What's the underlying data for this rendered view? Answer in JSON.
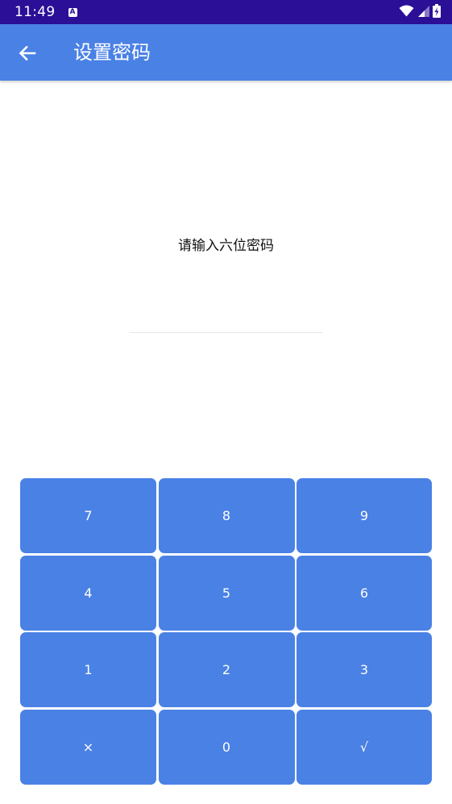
{
  "status_bar": {
    "time": "11:49",
    "icons": [
      "accessibility-icon",
      "wifi-icon",
      "signal-icon",
      "battery-charging-icon"
    ]
  },
  "app_bar": {
    "title": "设置密码",
    "back_icon": "arrow-left-icon"
  },
  "main": {
    "prompt": "请输入六位密码",
    "password_value": ""
  },
  "keypad": {
    "keys": [
      "7",
      "8",
      "9",
      "4",
      "5",
      "6",
      "1",
      "2",
      "3",
      "×",
      "0",
      "√"
    ]
  },
  "colors": {
    "status_bar": "#2b0f96",
    "primary": "#4a81e5",
    "key_text": "#ffffff"
  }
}
